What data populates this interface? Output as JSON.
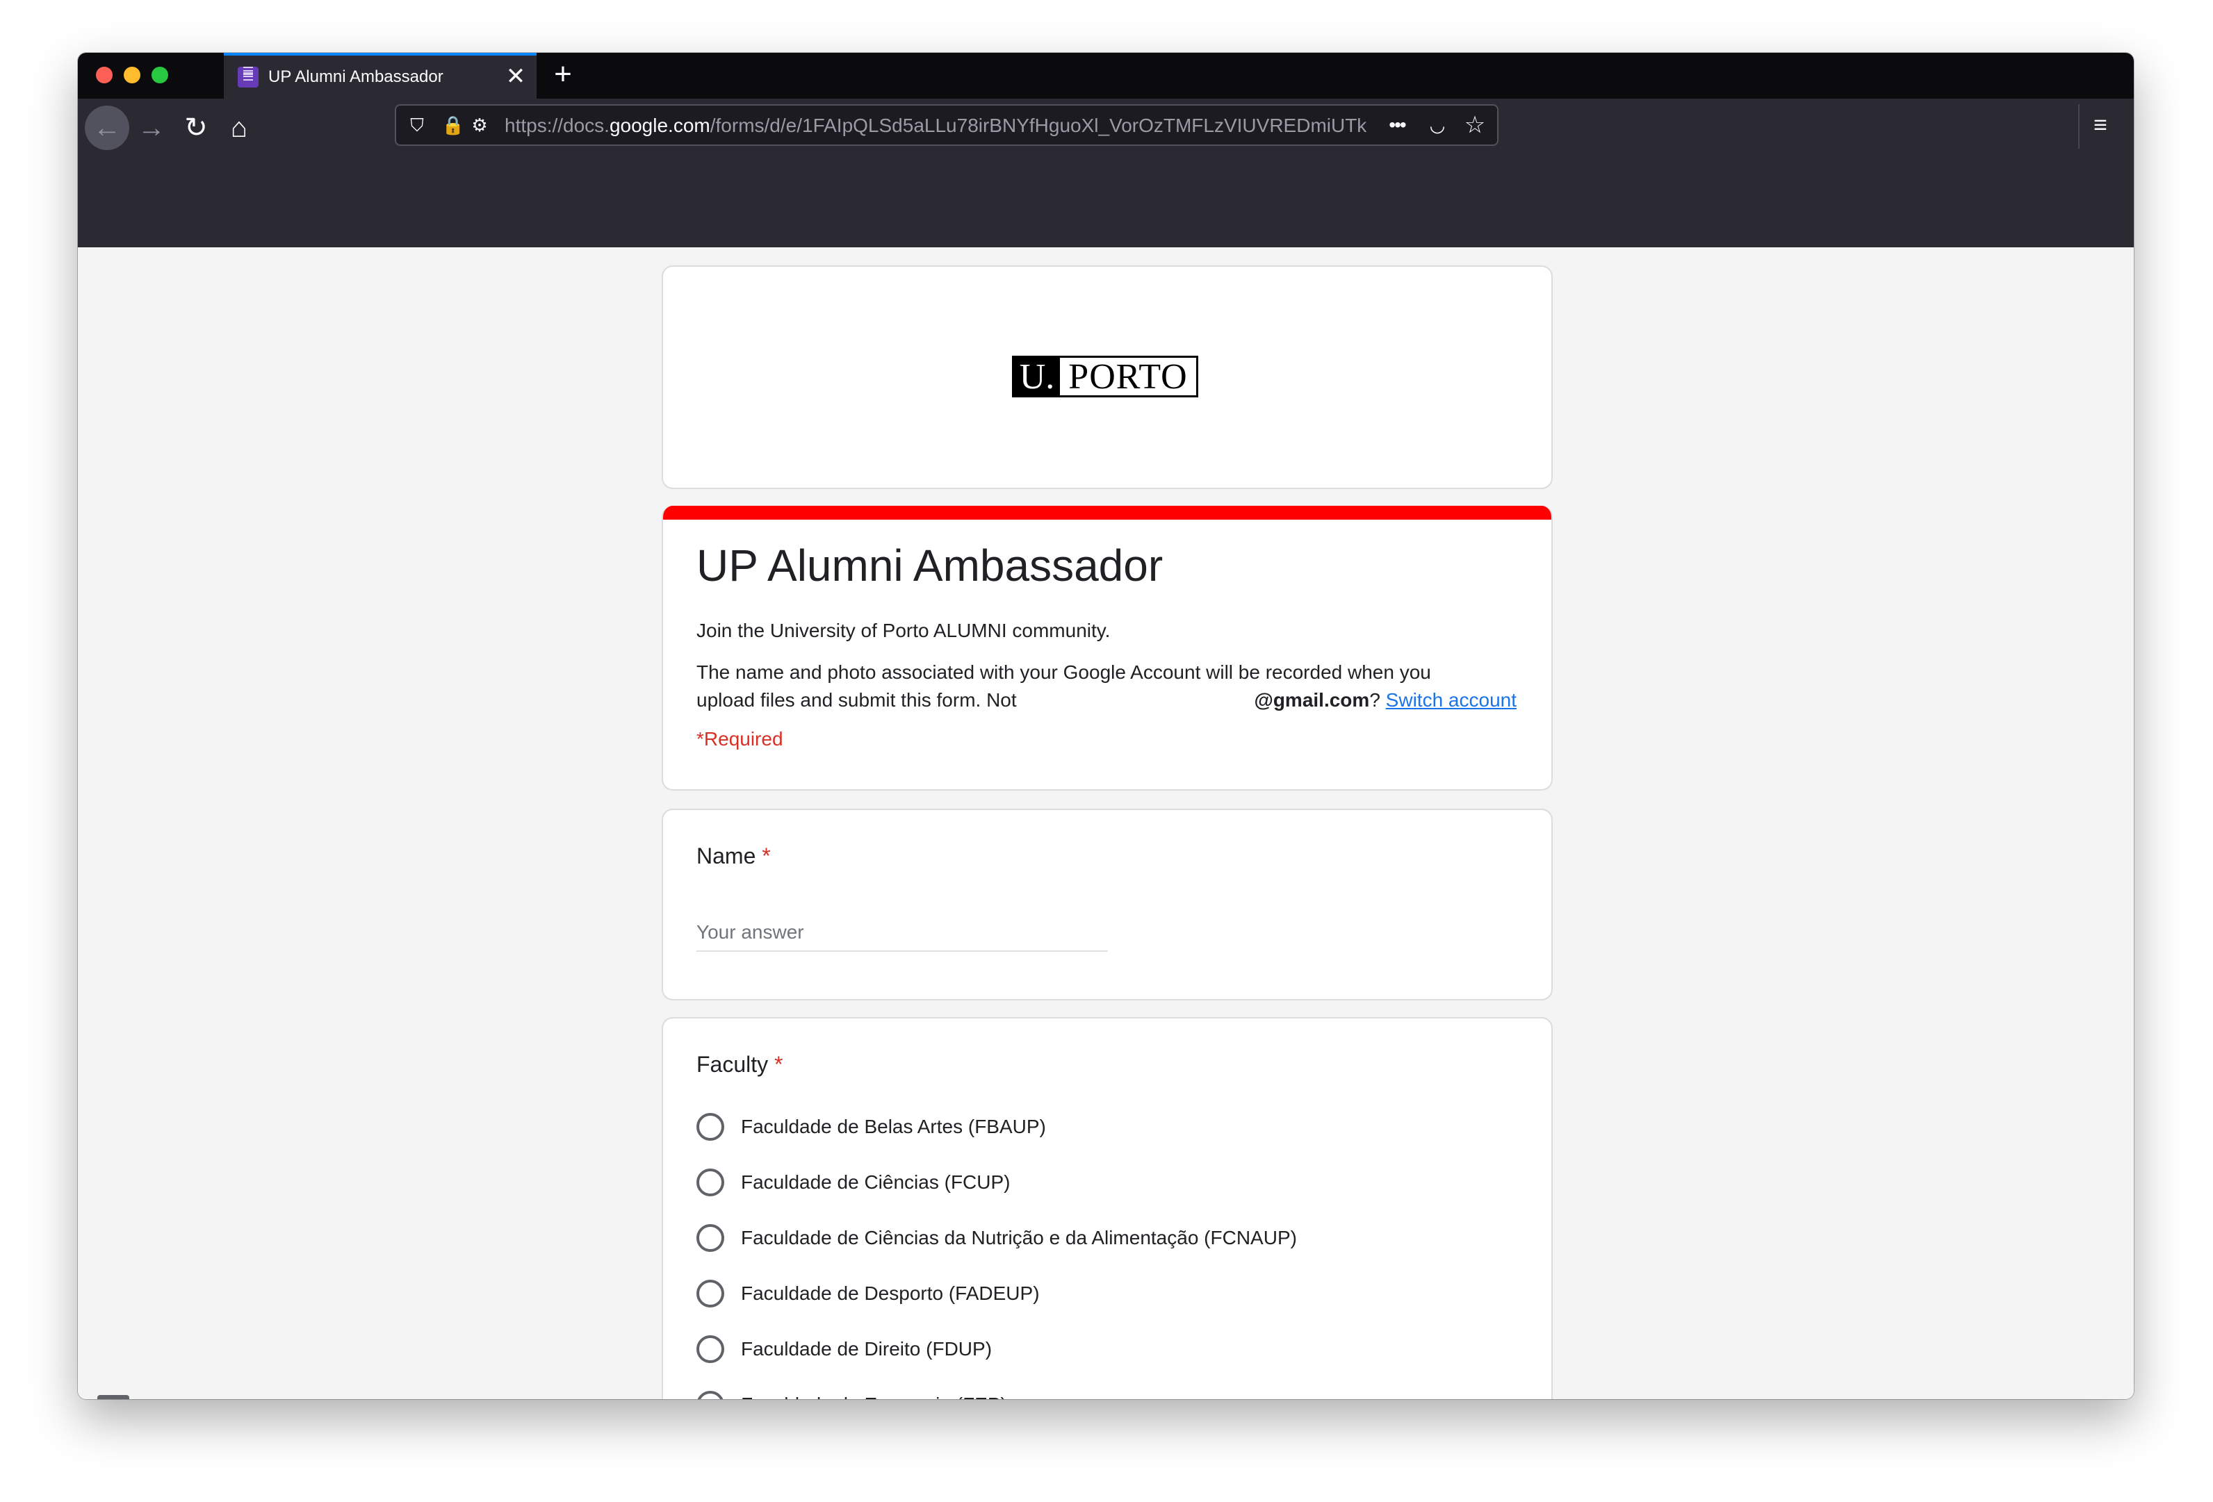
{
  "browser": {
    "tab_title": "UP Alumni Ambassador",
    "tab_close_glyph": "✕",
    "new_tab_glyph": "+",
    "url_prefix": "https://docs.",
    "url_domain": "google.com",
    "url_path": "/forms/d/e/1FAIpQLSd5aLLu78irBNYfHguoXl_VorOzTMFLzVIUVREDmiUTk",
    "icons": {
      "back": "←",
      "forward": "→",
      "reload": "↻",
      "home": "⌂",
      "shield": "⛉",
      "lock": "🔒",
      "permissions": "⚙",
      "more": "•••",
      "pocket": "◡",
      "bookmark": "☆",
      "menu": "≡"
    }
  },
  "header": {
    "logo_u": "U.",
    "logo_porto": "PORTO"
  },
  "form": {
    "title": "UP Alumni Ambassador",
    "description": "Join the  University of Porto ALUMNI community.",
    "notice_line1": "The name and photo associated with your Google Account will be recorded when you",
    "notice_line2": "upload files and submit this form. Not",
    "notice_email": "@gmail.com",
    "notice_question_mark": "?",
    "switch_account": "Switch account",
    "required_note": "*Required"
  },
  "questions": {
    "name": {
      "label": "Name",
      "required_mark": "*",
      "placeholder": "Your answer"
    },
    "faculty": {
      "label": "Faculty",
      "required_mark": "*",
      "options": [
        "Faculdade de Belas Artes (FBAUP)",
        "Faculdade de Ciências (FCUP)",
        "Faculdade de Ciências da Nutrição e da Alimentação (FCNAUP)",
        "Faculdade de Desporto (FADEUP)",
        "Faculdade de Direito (FDUP)",
        "Faculdade de Economia (FEP)"
      ]
    }
  },
  "floating": {
    "feedback_glyph": "!",
    "edit_glyph": "✎"
  },
  "colors": {
    "accent": "#ff0000",
    "link": "#1a73e8",
    "required": "#d93025",
    "page_bg": "#f4f4f4"
  }
}
